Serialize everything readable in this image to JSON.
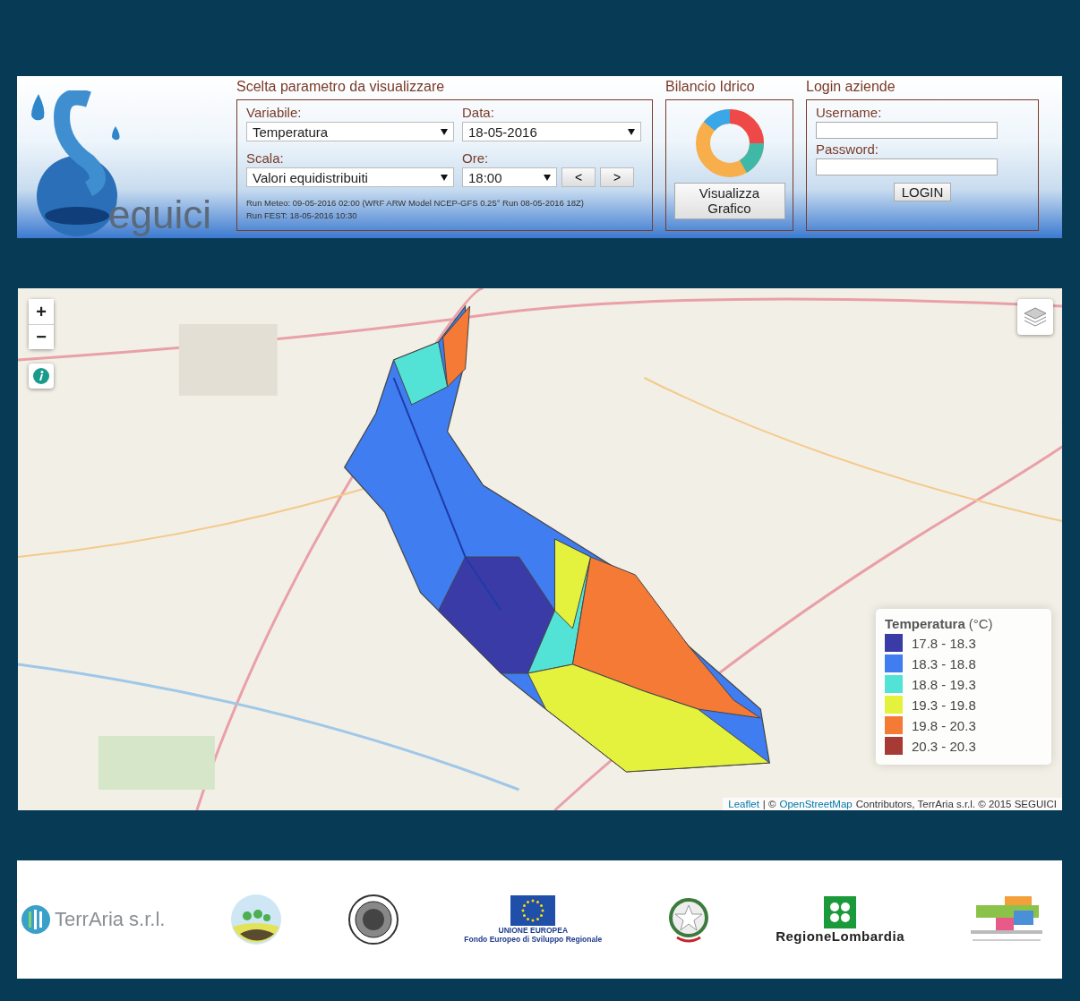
{
  "header": {
    "logo_text": "eguici",
    "params": {
      "title": "Scelta parametro da visualizzare",
      "fields": [
        {
          "label": "Variabile:",
          "value": "Temperatura"
        },
        {
          "label": "Data:",
          "value": "18-05-2016"
        },
        {
          "label": "Scala:",
          "value": "Valori equidistribuiti"
        },
        {
          "label": "Ore:",
          "value": "18:00"
        }
      ],
      "nav_buttons": [
        "<",
        ">"
      ],
      "run_info": [
        "Run Meteo: 09-05-2016 02:00 (WRF ARW Model NCEP-GFS 0.25° Run 08-05-2016 18Z)",
        "Run FEST: 18-05-2016 10:30"
      ]
    },
    "balance": {
      "title": "Bilancio Idrico",
      "button": "Visualizza Grafico"
    },
    "login": {
      "title": "Login aziende",
      "fields": [
        {
          "label": "Username:"
        },
        {
          "label": "Password:"
        }
      ],
      "button": "LOGIN"
    }
  },
  "map": {
    "zoom_buttons": [
      "+",
      "−"
    ],
    "legend": {
      "title": "Temperatura",
      "unit": "(°C)",
      "items": [
        {
          "label": "17.8 - 18.3",
          "color": "#3b3ba8"
        },
        {
          "label": "18.3 - 18.8",
          "color": "#3f7df0"
        },
        {
          "label": "18.8 - 19.3",
          "color": "#53e3d6"
        },
        {
          "label": "19.3 - 19.8",
          "color": "#e4f23d"
        },
        {
          "label": "19.8 - 20.3",
          "color": "#f47a35"
        },
        {
          "label": "20.3 - 20.3",
          "color": "#a83a36"
        }
      ]
    },
    "attribution": {
      "leaflet_link": "Leaflet",
      "separator": "| ©",
      "osm_link": "OpenStreetMap",
      "text": "Contributors, TerrAria s.r.l. © 2015 SEGUICI"
    }
  },
  "footer": {
    "logos": [
      {
        "kind": "terraria",
        "lines": [
          "TerrAria s.r.l."
        ]
      },
      {
        "kind": "leaf-circle"
      },
      {
        "kind": "seal"
      },
      {
        "kind": "eu",
        "lines": [
          "UNIONE EUROPEA",
          "Fondo Europeo di Sviluppo Regionale"
        ]
      },
      {
        "kind": "emblem"
      },
      {
        "kind": "lombardia",
        "lines": [
          "RegioneLombardia"
        ]
      },
      {
        "kind": "por"
      }
    ]
  }
}
